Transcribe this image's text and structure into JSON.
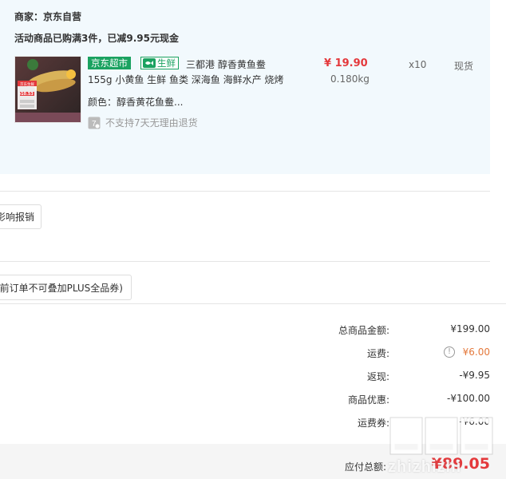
{
  "shop": {
    "merchant": "商家：京东自营",
    "promo": "活动商品已购满3件，已减9.95元现金"
  },
  "product": {
    "tag_jd": "京东超市",
    "tag_fresh": "生鲜",
    "title_line1": "三都港 醇香黄鱼鲞",
    "title_line2": "155g 小黄鱼 生鲜 鱼类 深海鱼 海鲜水产 烧烤",
    "color_label": "颜色：醇香黄花鱼鲞...",
    "return_policy": "不支持7天无理由退货",
    "price": "¥ 19.90",
    "weight": "0.180kg",
    "quantity": "x10",
    "stock": "现货",
    "thumb_text": {
      "line1": "京东生鲜",
      "line2": "10.53",
      "line3": "¥"
    }
  },
  "actions": {
    "invoice": "影响报销",
    "coupon": "前订单不可叠加PLUS全品券)"
  },
  "summary": {
    "rows": [
      {
        "label": "总商品金额:",
        "value": "¥199.00"
      },
      {
        "label": "运费:",
        "value": "¥6.00"
      },
      {
        "label": "返现:",
        "value": "-¥9.95"
      },
      {
        "label": "商品优惠:",
        "value": "-¥100.00"
      },
      {
        "label": "运费券:",
        "value": "-¥6.00"
      }
    ],
    "total_label": "应付总额:",
    "total_value": "¥89.05"
  },
  "watermark": "zhizhizhi",
  "colors": {
    "accent_red": "#e4393c",
    "fresh_green": "#1aa260",
    "shipping_orange": "#e4793c",
    "panel_bg": "#f2f9fd"
  }
}
